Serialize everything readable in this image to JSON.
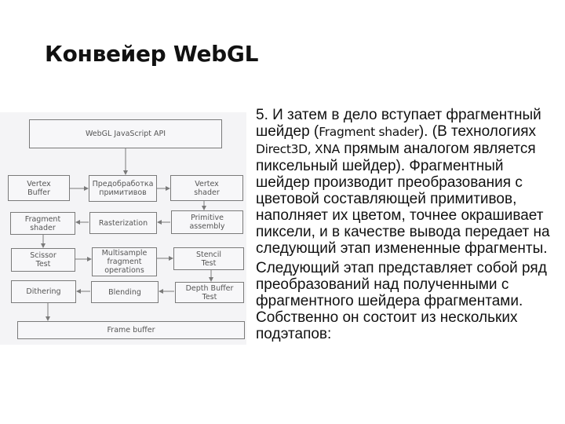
{
  "slide": {
    "title": "Конвейер WebGL"
  },
  "diagram": {
    "background": "#f4f4f6",
    "stroke_color": "#7a7a7a",
    "text_color": "#555555",
    "boxes": {
      "webgl_api": "WebGL JavaScript API",
      "vertex_buffer": "Vertex\nBuffer",
      "preprocessing": "Предобработка\nпримитивов",
      "vertex_shader": "Vertex\nshader",
      "fragment_shader": "Fragment\nshader",
      "rasterization": "Rasterization",
      "primitive_assembly": "Primitive\nassembly",
      "scissor_test": "Scissor\nTest",
      "multisample": "Multisample\nfragment\noperations",
      "stencil_test": "Stencil\nTest",
      "dithering": "Dithering",
      "blending": "Blending",
      "depth_buffer_test": "Depth Buffer\nTest",
      "frame_buffer": "Frame buffer"
    }
  },
  "body": {
    "paragraph1": {
      "part1": "5. И затем в дело вступает фрагментный шейдер (",
      "latin1": "Fragment shader",
      "part2": "). (В технологиях ",
      "latin2": "Direct3D, XNA",
      "part3": " прямым аналогом является пиксельный шейдер). Фрагментный шейдер производит преобразования с цветовой составляющей примитивов, наполняет их цветом, точнее окрашивает пиксели, и в качестве вывода передает на следующий этап измененные фрагменты."
    },
    "paragraph2": "Следующий этап представляет собой ряд преобразований над полученными с фрагментного шейдера фрагментами. Собственно он состоит из нескольких подэтапов:"
  }
}
